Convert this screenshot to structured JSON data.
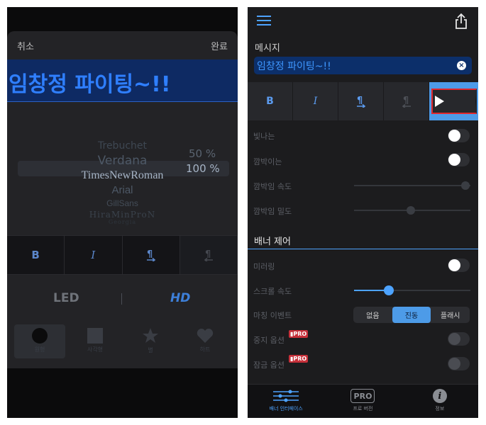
{
  "left": {
    "cancel_label": "취소",
    "done_label": "완료",
    "preview_text": "임창정 파이팅~!!",
    "fonts": [
      "Trebuchet",
      "Verdana",
      "TimesNewRoman",
      "Arial",
      "GillSans",
      "HiraMinProN",
      "Georgia"
    ],
    "selected_font": "TimesNewRoman",
    "percent_above": "50 %",
    "percent_selected": "100 %",
    "format_buttons": [
      "B",
      "I",
      "¶",
      "¶"
    ],
    "led_label": "LED",
    "hd_label": "HD",
    "shapes": [
      {
        "icon": "circle-icon",
        "label": "원형"
      },
      {
        "icon": "square-icon",
        "label": "사각형"
      },
      {
        "icon": "star-icon",
        "label": "별"
      },
      {
        "icon": "heart-icon",
        "label": "하트"
      }
    ]
  },
  "right": {
    "message_label": "메시지",
    "message_value": "임창정 파이팅~!!",
    "format_buttons": [
      "B",
      "I",
      "¶",
      "¶"
    ],
    "settings": {
      "glow_label": "빛나는",
      "blink_label": "깜박이는",
      "blink_speed_label": "깜박임 속도",
      "blink_density_label": "깜박임 밀도"
    },
    "banner_section_title": "배너 제어",
    "banner": {
      "mirror_label": "미러링",
      "scroll_speed_label": "스크롤 속도",
      "scroll_speed_value": 0.3,
      "finish_event_label": "마칭 이벤트",
      "finish_event_options": [
        "없음",
        "진동",
        "플래시"
      ],
      "finish_event_selected": "진동",
      "stop_option_label": "중지 옵션",
      "lock_option_label": "잠금 옵션",
      "pro_badge": "PRO"
    },
    "tabs": [
      {
        "label": "배너 인터페이스",
        "icon": "sliders-icon",
        "active": true
      },
      {
        "label": "프로 버전",
        "icon": "pro-icon",
        "badge": "PRO"
      },
      {
        "label": "정보",
        "icon": "info-icon",
        "glyph": "i"
      }
    ]
  },
  "colors": {
    "accent": "#4da3ff",
    "accent_fill": "#4d9be8",
    "title_blue": "#2f7fff",
    "highlight_red": "#e0282e",
    "pro_red": "#c6303a"
  }
}
